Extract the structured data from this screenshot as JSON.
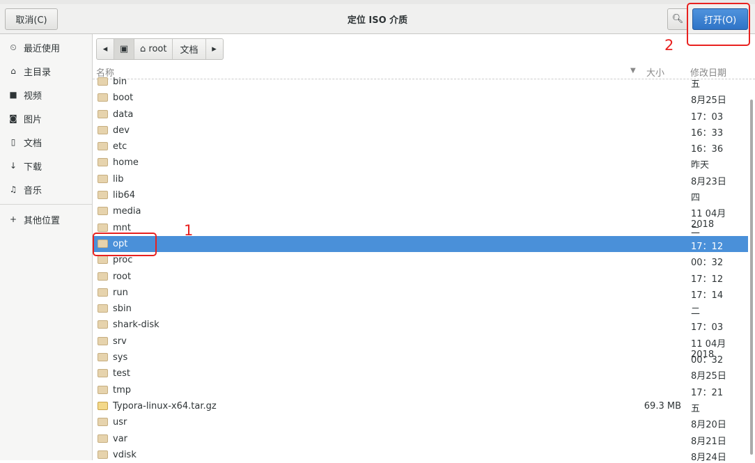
{
  "window": {
    "title": "定位 ISO 介质"
  },
  "header": {
    "cancel_label": "取消(C)",
    "open_label": "打开(O)",
    "search_icon": "search-icon"
  },
  "sidebar": {
    "items": [
      {
        "label": "最近使用",
        "icon": "clock-icon"
      },
      {
        "label": "主目录",
        "icon": "home-icon"
      },
      {
        "label": "视频",
        "icon": "video-icon"
      },
      {
        "label": "图片",
        "icon": "camera-icon"
      },
      {
        "label": "文档",
        "icon": "document-icon"
      },
      {
        "label": "下载",
        "icon": "download-icon"
      },
      {
        "label": "音乐",
        "icon": "music-icon"
      }
    ],
    "other_label": "其他位置"
  },
  "pathbar": {
    "items": [
      "root",
      "文档"
    ]
  },
  "columns": {
    "name": "名称",
    "size": "大小",
    "modified": "修改日期"
  },
  "files": [
    {
      "name": "bin",
      "size": "",
      "date": "五"
    },
    {
      "name": "boot",
      "size": "",
      "date": "8月25日"
    },
    {
      "name": "data",
      "size": "",
      "date": "17：03"
    },
    {
      "name": "dev",
      "size": "",
      "date": "16：33"
    },
    {
      "name": "etc",
      "size": "",
      "date": "16：36"
    },
    {
      "name": "home",
      "size": "",
      "date": "昨天"
    },
    {
      "name": "lib",
      "size": "",
      "date": "8月23日"
    },
    {
      "name": "lib64",
      "size": "",
      "date": "四"
    },
    {
      "name": "media",
      "size": "",
      "date": "11 04月 2018"
    },
    {
      "name": "mnt",
      "size": "",
      "date": "二"
    },
    {
      "name": "opt",
      "size": "",
      "date": "17：12",
      "selected": true
    },
    {
      "name": "proc",
      "size": "",
      "date": "00：32"
    },
    {
      "name": "root",
      "size": "",
      "date": "17：12"
    },
    {
      "name": "run",
      "size": "",
      "date": "17：14"
    },
    {
      "name": "sbin",
      "size": "",
      "date": "二"
    },
    {
      "name": "shark-disk",
      "size": "",
      "date": "17：03"
    },
    {
      "name": "srv",
      "size": "",
      "date": "11 04月 2018"
    },
    {
      "name": "sys",
      "size": "",
      "date": "00：32"
    },
    {
      "name": "test",
      "size": "",
      "date": "8月25日"
    },
    {
      "name": "tmp",
      "size": "",
      "date": "17：21"
    },
    {
      "name": "Typora-linux-x64.tar.gz",
      "size": "69.3 MB",
      "date": "五",
      "archive": true
    },
    {
      "name": "usr",
      "size": "",
      "date": "8月20日"
    },
    {
      "name": "var",
      "size": "",
      "date": "8月21日"
    },
    {
      "name": "vdisk",
      "size": "",
      "date": "8月24日"
    }
  ],
  "annotations": [
    "1",
    "2"
  ],
  "colors": {
    "accent": "#4a90d9",
    "annotation": "#e8211f"
  }
}
